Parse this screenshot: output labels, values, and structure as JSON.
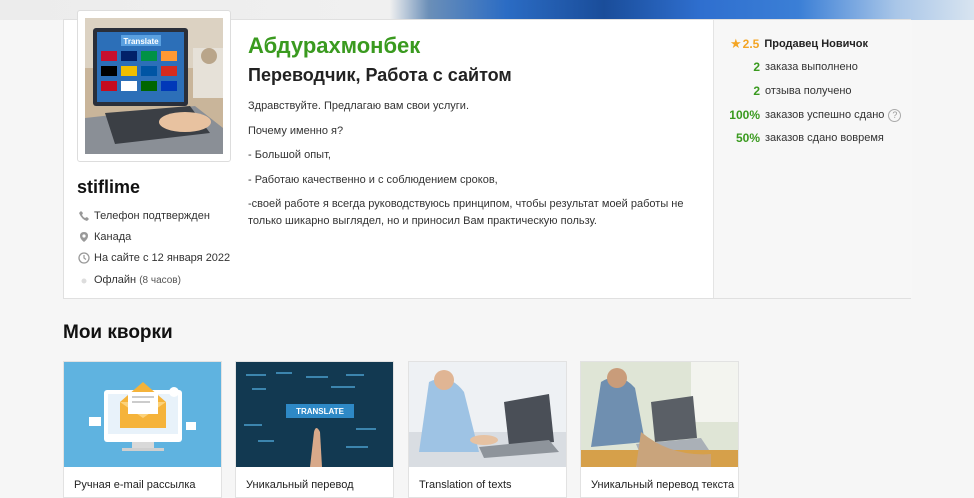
{
  "profile": {
    "username": "stiflime",
    "display_name": "Абдурахмонбек",
    "role": "Переводчик, Работа с сайтом",
    "avatar_text": "Translate",
    "info": {
      "phone": "Телефон подтвержден",
      "location": "Канада",
      "since": "На сайте с 12 января 2022",
      "status": "Офлайн",
      "status_note": "(8 часов)"
    },
    "description": [
      "Здравствуйте. Предлагаю вам свои услуги.",
      "Почему именно я?",
      "- Большой опыт,",
      "- Работаю качественно и с соблюдением сроков,",
      "-своей работе я всегда руководствуюсь принципом, чтобы результат моей работы не только шикарно выглядел, но и приносил Вам практическую пользу."
    ]
  },
  "stats": {
    "rating": "2.5",
    "level": "Продавец Новичок",
    "orders_done_num": "2",
    "orders_done_label": "заказа выполнено",
    "reviews_num": "2",
    "reviews_label": "отзыва получено",
    "success_num": "100%",
    "success_label": "заказов успешно сдано",
    "ontime_num": "50%",
    "ontime_label": "заказов сдано вовремя",
    "help_glyph": "?"
  },
  "kworks": {
    "title": "Мои кворки",
    "items": [
      {
        "title": "Ручная e-mail рассылка"
      },
      {
        "title": "Уникальный перевод",
        "thumb_text": "TRANSLATE"
      },
      {
        "title": "Translation of texts"
      },
      {
        "title": "Уникальный перевод текста"
      }
    ]
  },
  "colors": {
    "accent_green": "#3a9a1f",
    "star": "#f4a524"
  }
}
